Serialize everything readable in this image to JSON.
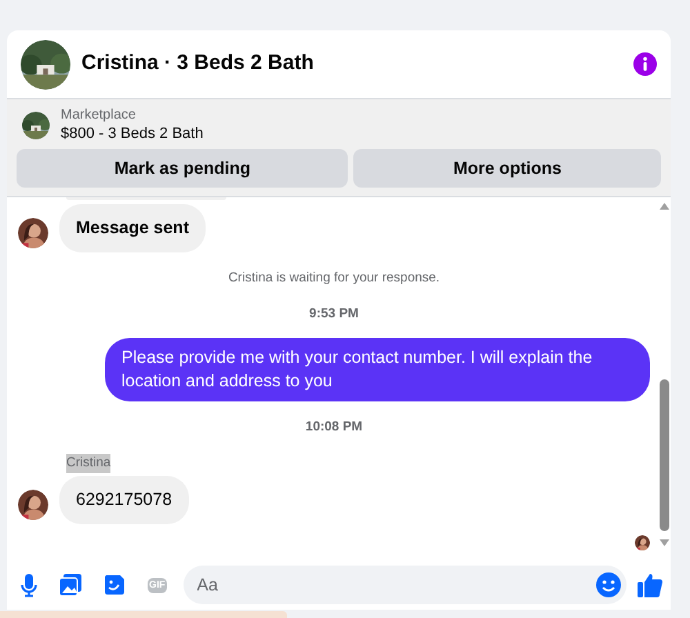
{
  "header": {
    "title": "Cristina · 3 Beds 2 Bath"
  },
  "listing": {
    "source": "Marketplace",
    "summary": "$800 - 3 Beds 2 Bath",
    "buttons": [
      "Mark as pending",
      "More options"
    ]
  },
  "messages": [
    {
      "kind": "cut_bubble"
    },
    {
      "kind": "incoming",
      "text": "Message sent",
      "bold": true
    },
    {
      "kind": "notice",
      "text": "Cristina is waiting for your response."
    },
    {
      "kind": "time",
      "text": "9:53 PM"
    },
    {
      "kind": "outgoing",
      "text": "Please provide me with your contact number. I will explain the location and address to you"
    },
    {
      "kind": "time",
      "text": "10:08 PM"
    },
    {
      "kind": "sender",
      "text": "Cristina",
      "highlighted": true
    },
    {
      "kind": "incoming",
      "text": "6292175078",
      "bold": false
    },
    {
      "kind": "seen"
    }
  ],
  "composer": {
    "gif_label": "GIF",
    "placeholder": "Aa"
  }
}
